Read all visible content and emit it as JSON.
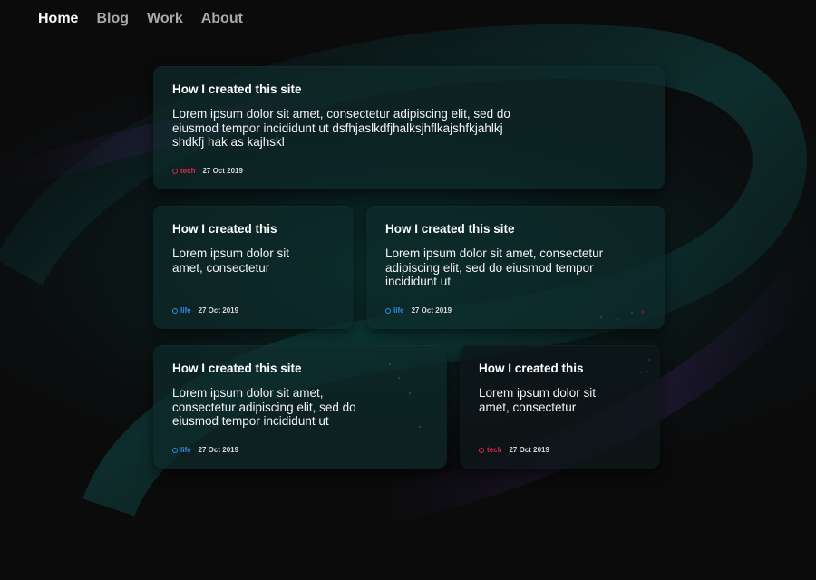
{
  "nav": {
    "items": [
      {
        "label": "Home",
        "active": true
      },
      {
        "label": "Blog",
        "active": false
      },
      {
        "label": "Work",
        "active": false
      },
      {
        "label": "About",
        "active": false
      }
    ]
  },
  "colors": {
    "tech": "#e0254d",
    "life": "#2f8ee8"
  },
  "posts": [
    {
      "title": "How I created this site",
      "excerpt": "Lorem ipsum dolor sit amet, consectetur adipiscing elit, sed do eiusmod tempor incididunt ut dsfhjaslkdfjhalksjhflkajshfkjahlkj shdkfj hak as kajhskl",
      "tag": "tech",
      "date": "27 Oct 2019"
    },
    {
      "title": "How I created this",
      "excerpt": "Lorem ipsum dolor sit amet, consectetur",
      "tag": "life",
      "date": "27 Oct 2019"
    },
    {
      "title": "How I created this site",
      "excerpt": "Lorem ipsum dolor sit amet, consectetur adipiscing elit, sed do eiusmod tempor incididunt ut",
      "tag": "life",
      "date": "27 Oct 2019"
    },
    {
      "title": "How I created this site",
      "excerpt": "Lorem ipsum dolor sit amet, consectetur adipiscing elit, sed do eiusmod tempor incididunt ut",
      "tag": "life",
      "date": "27 Oct 2019"
    },
    {
      "title": "How I created this",
      "excerpt": "Lorem ipsum dolor sit amet, consectetur",
      "tag": "tech",
      "date": "27 Oct 2019"
    }
  ]
}
